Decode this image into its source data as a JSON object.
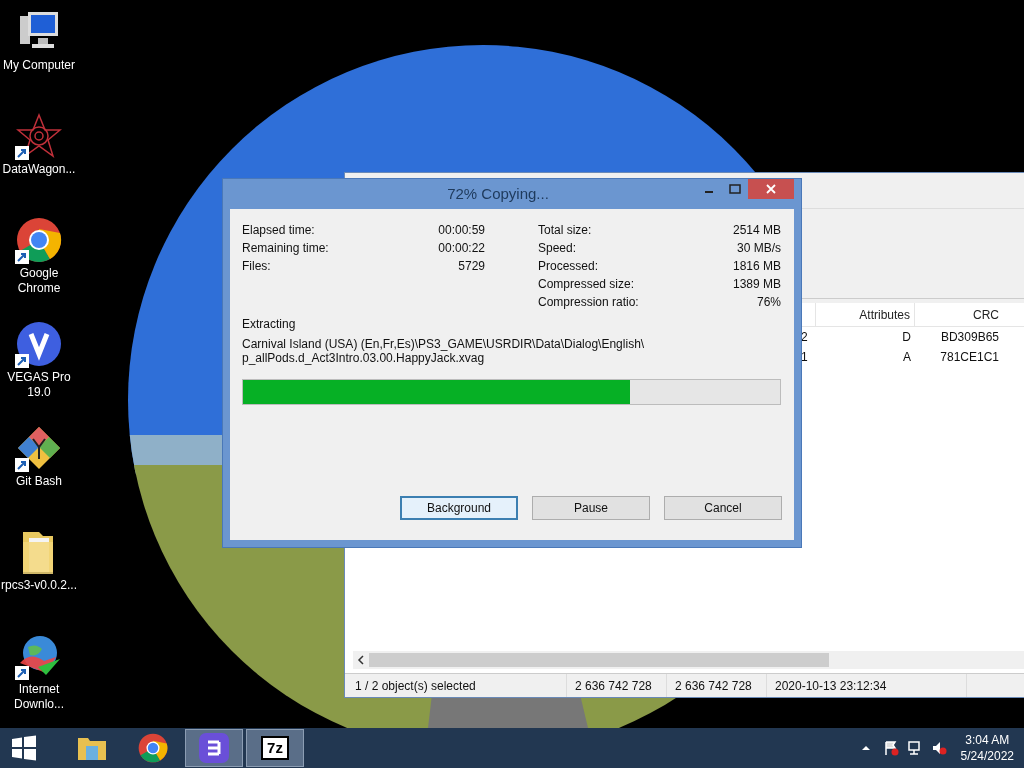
{
  "desktop_icons": [
    {
      "label": "My Computer",
      "kind": "computer",
      "shortcut": false
    },
    {
      "label": "DataWagon...",
      "kind": "star",
      "shortcut": true
    },
    {
      "label": "Google Chrome",
      "kind": "chrome",
      "shortcut": true
    },
    {
      "label": "VEGAS Pro 19.0",
      "kind": "vegas",
      "shortcut": true
    },
    {
      "label": "Git Bash",
      "kind": "git",
      "shortcut": true
    },
    {
      "label": "rpcs3-v0.0.2...",
      "kind": "folder",
      "shortcut": false
    },
    {
      "label": "Internet Downlo...",
      "kind": "globe",
      "shortcut": true
    }
  ],
  "file_manager": {
    "columns": [
      {
        "label": "Attributes"
      },
      {
        "label": "CRC"
      }
    ],
    "rows": [
      {
        "column_1": "2",
        "attributes": "D",
        "crc": "BD309B65"
      },
      {
        "column_1": "1",
        "attributes": "A",
        "crc": "781CE1C1"
      }
    ],
    "status_bar": [
      "1 / 2 object(s) selected",
      "2 636 742 728",
      "2 636 742 728",
      "2020-10-13 23:12:34"
    ]
  },
  "dialog": {
    "title": "72% Copying...",
    "left_stats": [
      {
        "label": "Elapsed time:",
        "value": "00:00:59"
      },
      {
        "label": "Remaining time:",
        "value": "00:00:22"
      },
      {
        "label": "Files:",
        "value": "5729"
      }
    ],
    "right_stats": [
      {
        "label": "Total size:",
        "value": "2514 MB"
      },
      {
        "label": "Speed:",
        "value": "30 MB/s"
      },
      {
        "label": "Processed:",
        "value": "1816 MB"
      },
      {
        "label": "Compressed size:",
        "value": "1389 MB"
      },
      {
        "label": "Compression ratio:",
        "value": "76%"
      }
    ],
    "action": "Extracting",
    "path_lines": [
      "Carnival Island (USA) (En,Fr,Es)\\PS3_GAME\\USRDIR\\Data\\Dialog\\English\\",
      "p_allPods.d_Act3Intro.03.00.HappyJack.xvag"
    ],
    "progress": {
      "level": 0.72
    },
    "buttons": [
      {
        "label": "Background",
        "default": true
      },
      {
        "label": "Pause",
        "default": false
      },
      {
        "label": "Cancel",
        "default": false
      }
    ]
  },
  "taskbar": {
    "apps": [
      {
        "kind": "explorer",
        "active": false
      },
      {
        "kind": "chrome",
        "active": false
      },
      {
        "kind": "b-app",
        "active": true
      },
      {
        "kind": "sevenzip",
        "label": "7z",
        "active": true
      }
    ],
    "clock": {
      "time": "3:04 AM",
      "date": "5/24/2022"
    }
  }
}
